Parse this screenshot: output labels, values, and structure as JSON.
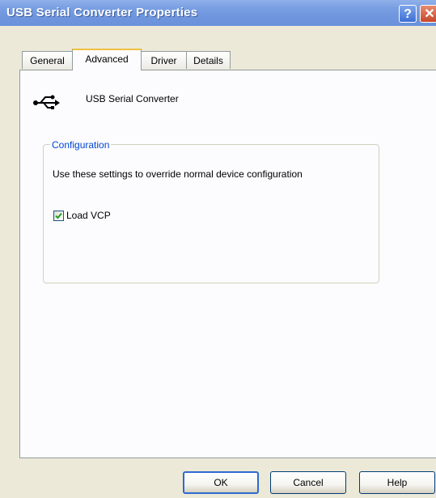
{
  "window": {
    "title": "USB Serial Converter Properties",
    "help_button": "?",
    "close_button": "✕",
    "title_gradient_color": "#6f96de"
  },
  "tabs": [
    {
      "label": "General",
      "active": false
    },
    {
      "label": "Advanced",
      "active": true
    },
    {
      "label": "Driver",
      "active": false
    },
    {
      "label": "Details",
      "active": false
    }
  ],
  "device": {
    "icon": "usb-icon",
    "name": "USB Serial Converter"
  },
  "configuration": {
    "group_label": "Configuration",
    "description": "Use these settings to override normal device configuration",
    "load_vcp": {
      "label": "Load VCP",
      "checked": true
    }
  },
  "buttons": {
    "ok": "OK",
    "cancel": "Cancel",
    "help": "Help"
  }
}
